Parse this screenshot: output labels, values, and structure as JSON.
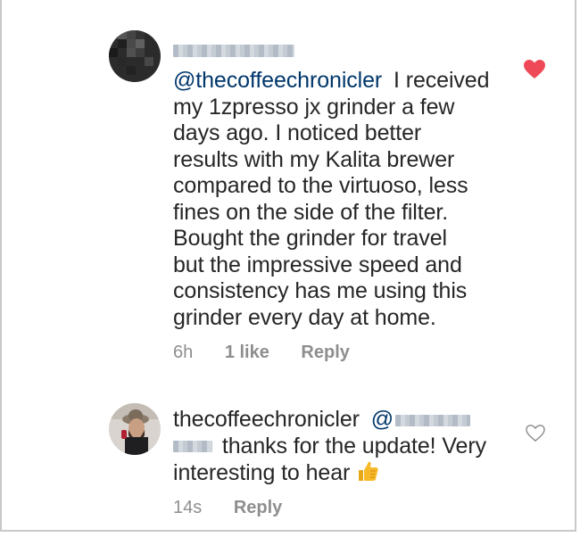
{
  "comment1": {
    "mention": "@thecoffeechronicler",
    "text_lines": [
      "I received",
      "my 1zpresso jx grinder a few",
      "days ago. I noticed better",
      "results with my Kalita brewer",
      "compared to the virtuoso, less",
      "fines on the side of the filter.",
      "Bought the grinder for travel",
      "but the impressive speed and",
      "consistency has me using this",
      "grinder every day at home."
    ],
    "time": "6h",
    "likes": "1 like",
    "reply_label": "Reply",
    "liked": true,
    "heart_color": "#ed4956",
    "icon": "heart-filled-icon"
  },
  "comment2": {
    "username": "thecoffeechronicler",
    "mention_prefix": "@",
    "text_line1": "thanks for the update! Very",
    "text_line2": "interesting to hear",
    "emoji": "thumbs-up-icon",
    "time": "14s",
    "reply_label": "Reply",
    "liked": false,
    "icon": "heart-outline-icon"
  },
  "colors": {
    "text": "#262626",
    "mention": "#00376b",
    "meta": "#8e8e8e"
  }
}
